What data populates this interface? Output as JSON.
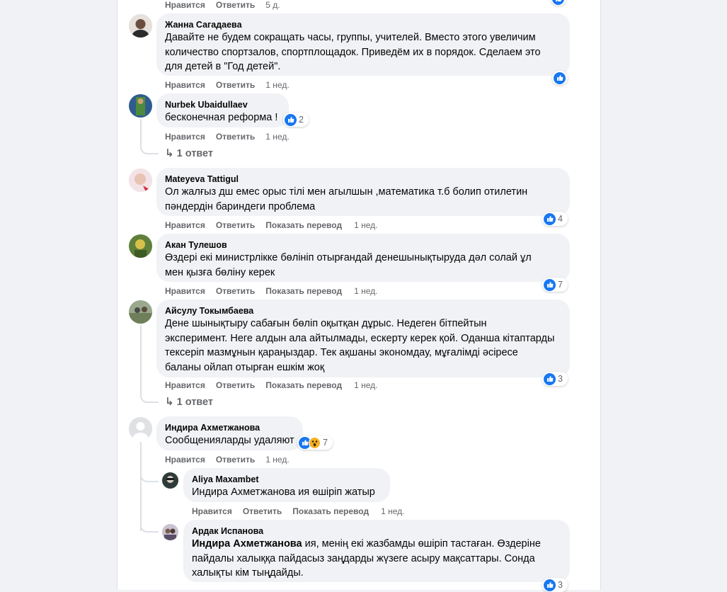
{
  "colors": {
    "like": "#1877f2",
    "wow": "#f7b125",
    "muted": "#65676b",
    "bubble": "#f0f2f5"
  },
  "actions": {
    "like": "Нравится",
    "reply": "Ответить",
    "translate": "Показать перевод"
  },
  "top_row": {
    "time": "5 д."
  },
  "comments": [
    {
      "author": "Жанна Сагадаева",
      "lines": [
        "Давайте не будем сокращать часы, группы, учителей. Вместо этого увеличим",
        "количество спортзалов, спортплощадок. Приведём их в порядок. Сделаем это",
        "для детей в \"Год детей\"."
      ],
      "time": "1 нед.",
      "reaction_icon": "like-icon"
    },
    {
      "author": "Nurbek Ubaidullaev",
      "lines": [
        "бесконечная реформа !"
      ],
      "time": "1 нед.",
      "reactions": "2",
      "replies_link": "1 ответ"
    },
    {
      "author": "Mateyeva Tattigul",
      "lines": [
        "Ол жалғыз дш емес орыс тілі мен агылшын ,математика т.б болип отилетин",
        "пәндердін бариндеги проблема"
      ],
      "time": "1 нед.",
      "reactions": "4"
    },
    {
      "author": "Акан Тулешов",
      "lines": [
        "Өздері екі министрлікке бөлініп отырғандай денешынықтыруда дәл солай ұл",
        "мен қызға бөліну керек"
      ],
      "time": "1 нед.",
      "reactions": "7"
    },
    {
      "author": "Айсулу Токымбаева",
      "lines": [
        "Дене шынықтыру сабағын бөліп оқытқан дұрыс. Недеген бітпейтын",
        "эксперимент. Неге алдын ала айтылмады, ескерту керек қой. Оданша кітаптарды",
        "тексеріп мазмұнын қараңыздар. Тек ақшаны экономдау, мұғалімді әсіресе",
        "баланы ойлап отырған ешкім жоқ"
      ],
      "time": "1 нед.",
      "reactions": "3",
      "replies_link": "1 ответ"
    },
    {
      "author": "Индира Ахметжанова",
      "lines": [
        "Сообщенияларды удаляют"
      ],
      "time": "1 нед.",
      "reactions": "7",
      "reaction_icons": [
        "like-icon",
        "wow-icon"
      ]
    }
  ],
  "replies": [
    {
      "author": "Aliya Maxambet",
      "lines": [
        "Индира Ахметжанова ия өшіріп жатыр"
      ],
      "time": "1 нед."
    },
    {
      "author": "Ардак Испанова",
      "mention": "Индира Ахметжанова",
      "lines": [
        " ия, менің екі жазбамды өшіріп тастаған. Өздеріне",
        "пайдалы халыққа пайдасыз заңдарды жүзеге асыру мақсаттары. Сонда",
        "халықты кім тыңдайды."
      ],
      "reactions": "3"
    }
  ]
}
